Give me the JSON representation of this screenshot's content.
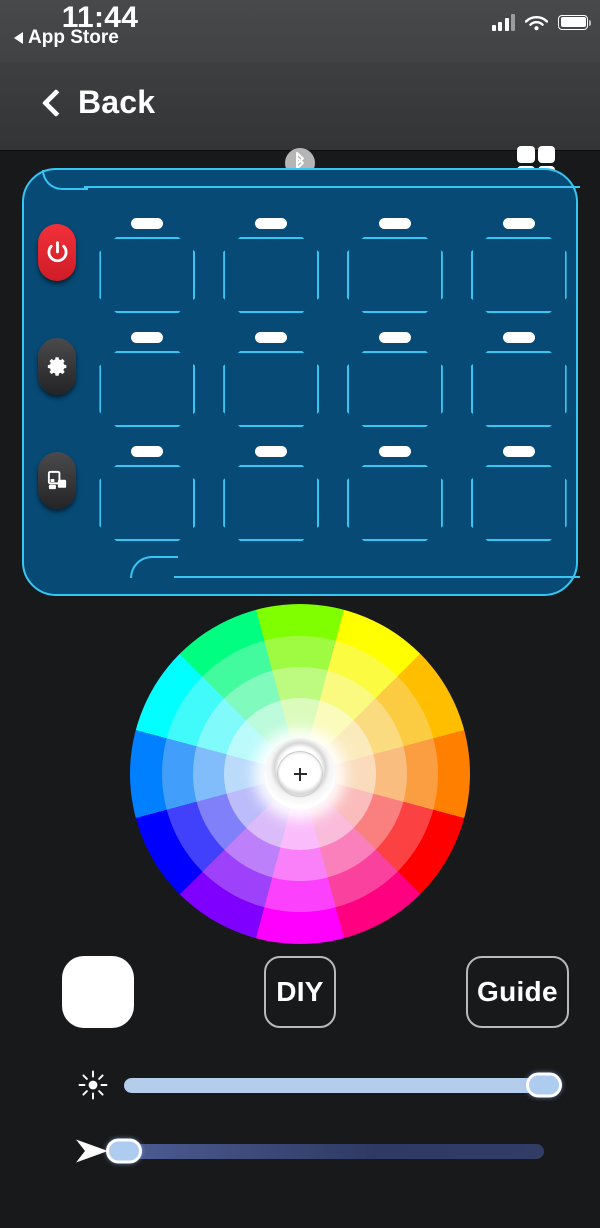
{
  "status_bar": {
    "time": "11:44",
    "back_app_label": "App Store",
    "back_arrow_icon": "triangle-left-icon",
    "signal_icon": "cellular-signal-icon",
    "wifi_icon": "wifi-icon",
    "battery_icon": "battery-full-icon"
  },
  "nav_bar": {
    "back_label": "Back",
    "back_icon": "chevron-left-icon",
    "bluetooth_icon": "bluetooth-icon",
    "grid_icon": "grid-2x2-icon"
  },
  "device_panel": {
    "accent_color": "#35c6f4",
    "body_color": "#074a75",
    "side_buttons": [
      {
        "name": "power",
        "icon": "power-icon",
        "color": "#e62b35"
      },
      {
        "name": "settings",
        "icon": "gear-icon",
        "color": "#333335"
      },
      {
        "name": "mode",
        "icon": "layout-blocks-icon",
        "color": "#333335"
      }
    ],
    "keys": [
      {
        "id": "key-1"
      },
      {
        "id": "key-2"
      },
      {
        "id": "key-3"
      },
      {
        "id": "key-4"
      },
      {
        "id": "key-5"
      },
      {
        "id": "key-6"
      },
      {
        "id": "key-7"
      },
      {
        "id": "key-8"
      },
      {
        "id": "key-9"
      },
      {
        "id": "key-10"
      },
      {
        "id": "key-11"
      },
      {
        "id": "key-12"
      }
    ]
  },
  "color_wheel": {
    "segments": 12,
    "rings": 4,
    "hues": [
      90,
      60,
      45,
      30,
      0,
      330,
      300,
      270,
      240,
      210,
      180,
      150
    ],
    "hue_colors": [
      "#00e000",
      "#ffe600",
      "#ff9500",
      "#ff2a00",
      "#ff0059",
      "#ff00b4",
      "#ee00ff",
      "#8c00ff",
      "#1a00ff",
      "#0090ff",
      "#00eaff",
      "#00ff8c"
    ],
    "center_knob_icon": "crosshair-icon",
    "selected_color": "#ffffff"
  },
  "actions": {
    "swatch_color": "#ffffff",
    "diy_label": "DIY",
    "guide_label": "Guide"
  },
  "sliders": {
    "brightness": {
      "icon": "brightness-sun-icon",
      "value": 100,
      "fill_color": "#b4cdeb"
    },
    "speed": {
      "icon": "speed-arrow-icon",
      "value": 0,
      "fill_color": "#3a4877"
    }
  }
}
